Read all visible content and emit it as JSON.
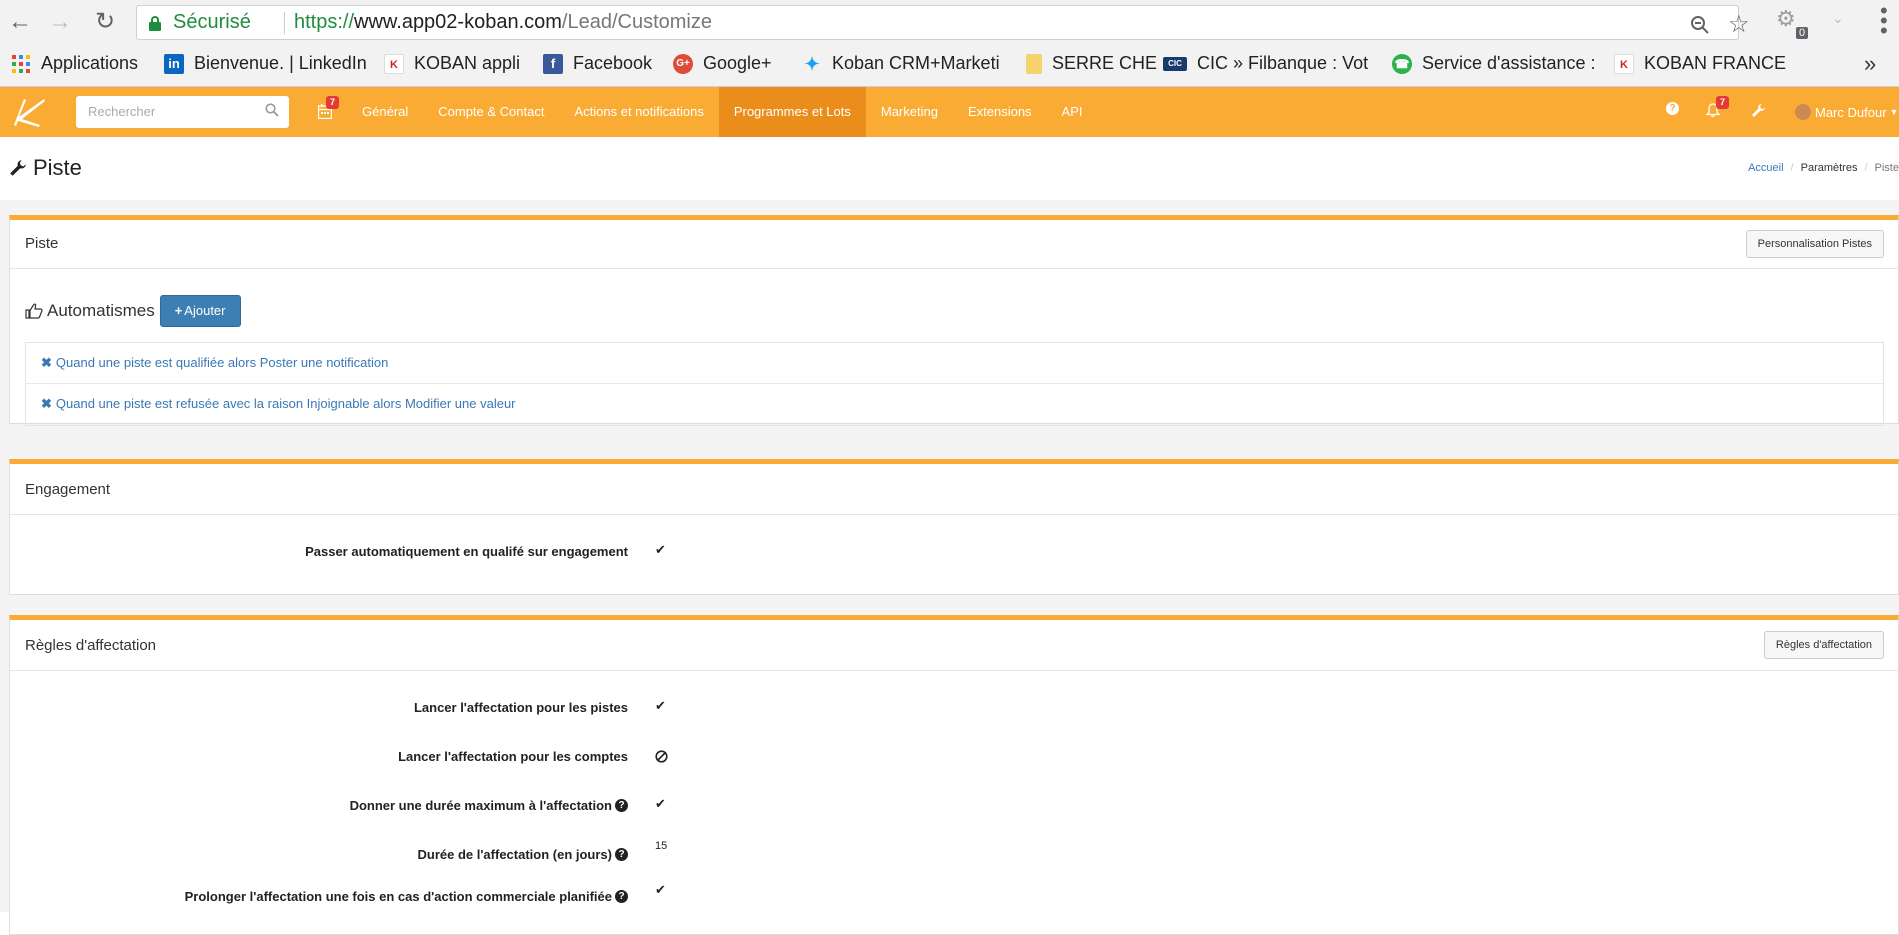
{
  "browser": {
    "secure_label": "Sécurisé",
    "url_scheme": "https://",
    "url_host": "www.app02-koban.com",
    "url_path": "/Lead/Customize",
    "extension_badge": "0",
    "bookmarks": [
      {
        "label": "Applications",
        "icon": "apps-grid-icon"
      },
      {
        "label": "Bienvenue. | LinkedIn",
        "icon": "linkedin-icon"
      },
      {
        "label": "KOBAN appli",
        "icon": "koban-favicon"
      },
      {
        "label": "Facebook",
        "icon": "facebook-icon"
      },
      {
        "label": "Google+",
        "icon": "google-plus-icon"
      },
      {
        "label": "Koban CRM+Marketi",
        "icon": "twitter-icon"
      },
      {
        "label": "SERRE CHE",
        "icon": "folder-icon"
      },
      {
        "label": "CIC » Filbanque : Vot",
        "icon": "cic-icon"
      },
      {
        "label": "Service d'assistance :",
        "icon": "headset-icon"
      },
      {
        "label": "KOBAN FRANCE",
        "icon": "koban-favicon"
      }
    ],
    "bookmarks_more": "»"
  },
  "topbar": {
    "search_placeholder": "Rechercher",
    "calendar_badge": "7",
    "notification_badge": "7",
    "menu": [
      {
        "label": "Général",
        "active": false
      },
      {
        "label": "Compte & Contact",
        "active": false
      },
      {
        "label": "Actions et notifications",
        "active": false
      },
      {
        "label": "Programmes et Lots",
        "active": true
      },
      {
        "label": "Marketing",
        "active": false
      },
      {
        "label": "Extensions",
        "active": false
      },
      {
        "label": "API",
        "active": false
      }
    ],
    "user_name": "Marc Dufour",
    "accent_color": "#f9ab34",
    "active_color": "#eb8d1b"
  },
  "page": {
    "title": "Piste",
    "breadcrumb": [
      "Accueil",
      "Paramètres",
      "Piste"
    ]
  },
  "panels": {
    "piste": {
      "title": "Piste",
      "button": "Personnalisation Pistes",
      "automations_title": "Automatismes",
      "add_button": "Ajouter",
      "automations": [
        "Quand une piste est qualifiée alors Poster une notification",
        "Quand une piste est refusée avec la raison Injoignable alors Modifier une valeur"
      ]
    },
    "engagement": {
      "title": "Engagement",
      "rows": [
        {
          "label": "Passer automatiquement en qualifé sur engagement",
          "value": "check",
          "help": false
        }
      ]
    },
    "affectation": {
      "title": "Règles d'affectation",
      "button": "Règles d'affectation",
      "rows": [
        {
          "label": "Lancer l'affectation pour les pistes",
          "value": "check",
          "help": false
        },
        {
          "label": "Lancer l'affectation pour les comptes",
          "value": "ban",
          "help": false
        },
        {
          "label": "Donner une durée maximum à l'affectation",
          "value": "check",
          "help": true
        },
        {
          "label": "Durée de l'affectation (en jours)",
          "value": "15",
          "help": true
        },
        {
          "label": "Prolonger l'affectation une fois en cas d'action commerciale planifiée",
          "value": "check",
          "help": true
        }
      ]
    }
  }
}
